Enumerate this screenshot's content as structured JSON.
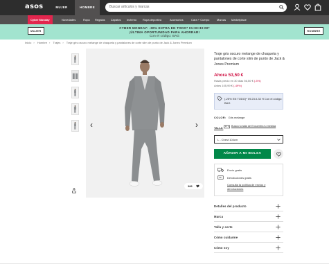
{
  "header": {
    "logo": "asos",
    "gender_tabs": [
      {
        "label": "MUJER"
      },
      {
        "label": "HOMBRE"
      }
    ],
    "search_placeholder": "Buscar artículos y marcas"
  },
  "categories": [
    {
      "label": "Cyber Monday",
      "promo": true
    },
    {
      "label": "Novedades"
    },
    {
      "label": "Ropa"
    },
    {
      "label": "Regalos"
    },
    {
      "label": "Zapatos"
    },
    {
      "label": "Invierno"
    },
    {
      "label": "Ropa deportiva"
    },
    {
      "label": "Accesorios"
    },
    {
      "label": "Cara + Cuerpo"
    },
    {
      "label": "Marcas"
    },
    {
      "label": "Marketplace"
    }
  ],
  "banner": {
    "left_button": "MUJER",
    "right_button": "HOMBRE",
    "line1": "CYBER MONDAY: -30% EXTRA EN TODO* 01:00:33:00*",
    "line2": "¡ÚLTIMA OPORTUNIDAD PARA AHORRAR!",
    "line3": "Con el código: BAG",
    "colors": {
      "bg": "#a2e4cf"
    }
  },
  "breadcrumb": [
    "Inicio",
    "Hombre",
    "Trajes",
    "Traje gris oscuro melange de chaqueta y pantalones de corte slim de punto de Jack & Jones Premium"
  ],
  "product": {
    "title": "Traje gris oscuro melange de chaqueta y pantalones de corte slim de punto de Jack & Jones Premium",
    "price_now": "Ahora 53,50 €",
    "price_was": "Hasta precio en 30 días 56,50 €",
    "price_was_pct": "(-5%)",
    "price_rrp": "Antes 105,99 €",
    "price_rrp_pct": "(-49%)",
    "promo_text": "(-25% EN TODO)* 09.23 A 33 H Con el código: BAG",
    "color_label": "COLOR:",
    "color_value": "Gris melange",
    "size_label": "TALLA:",
    "size_link": "Busca tu talla de Encuentra tu medida",
    "size_selected": "L - Chest 104cm",
    "add_to_bag": "AÑADIR A MI BOLSA",
    "likes": "386",
    "colors": {
      "accent": "#018849",
      "sale": "#d01345"
    }
  },
  "delivery": {
    "free_shipping": "Envío gratis",
    "free_returns": "Devoluciones gratis",
    "policy_link": "Consulta la política de envíos y devoluciones"
  },
  "accordion": [
    {
      "label": "Detalles del producto"
    },
    {
      "label": "Marca"
    },
    {
      "label": "Talla y corte"
    },
    {
      "label": "Cómo cuidarme"
    },
    {
      "label": "Cómo soy"
    }
  ]
}
